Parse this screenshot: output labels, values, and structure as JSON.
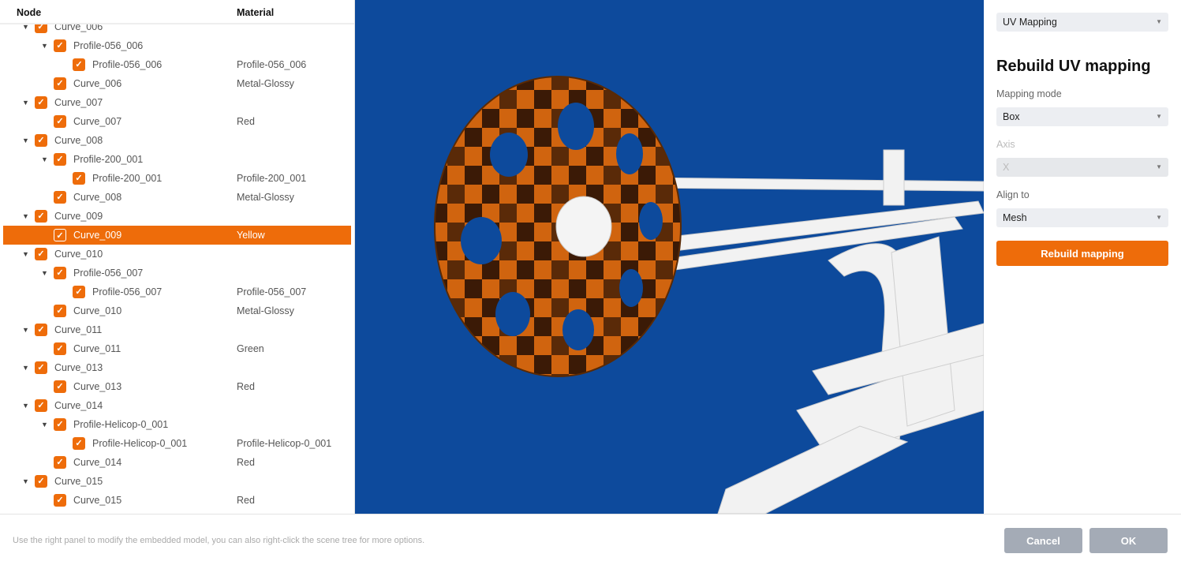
{
  "tree": {
    "headers": {
      "node": "Node",
      "material": "Material"
    },
    "rows": [
      {
        "name": "Curve_006",
        "level": 0,
        "material": "",
        "expander": true
      },
      {
        "name": "Profile-056_006",
        "level": 1,
        "material": "",
        "expander": true
      },
      {
        "name": "Profile-056_006",
        "level": 2,
        "material": "Profile-056_006",
        "expander": false
      },
      {
        "name": "Curve_006",
        "level": 1,
        "material": "Metal-Glossy",
        "expander": false
      },
      {
        "name": "Curve_007",
        "level": 0,
        "material": "",
        "expander": true
      },
      {
        "name": "Curve_007",
        "level": 1,
        "material": "Red",
        "expander": false
      },
      {
        "name": "Curve_008",
        "level": 0,
        "material": "",
        "expander": true
      },
      {
        "name": "Profile-200_001",
        "level": 1,
        "material": "",
        "expander": true
      },
      {
        "name": "Profile-200_001",
        "level": 2,
        "material": "Profile-200_001",
        "expander": false
      },
      {
        "name": "Curve_008",
        "level": 1,
        "material": "Metal-Glossy",
        "expander": false
      },
      {
        "name": "Curve_009",
        "level": 0,
        "material": "",
        "expander": true
      },
      {
        "name": "Curve_009",
        "level": 1,
        "material": "Yellow",
        "expander": false,
        "selected": true
      },
      {
        "name": "Curve_010",
        "level": 0,
        "material": "",
        "expander": true
      },
      {
        "name": "Profile-056_007",
        "level": 1,
        "material": "",
        "expander": true
      },
      {
        "name": "Profile-056_007",
        "level": 2,
        "material": "Profile-056_007",
        "expander": false
      },
      {
        "name": "Curve_010",
        "level": 1,
        "material": "Metal-Glossy",
        "expander": false
      },
      {
        "name": "Curve_011",
        "level": 0,
        "material": "",
        "expander": true
      },
      {
        "name": "Curve_011",
        "level": 1,
        "material": "Green",
        "expander": false
      },
      {
        "name": "Curve_013",
        "level": 0,
        "material": "",
        "expander": true
      },
      {
        "name": "Curve_013",
        "level": 1,
        "material": "Red",
        "expander": false
      },
      {
        "name": "Curve_014",
        "level": 0,
        "material": "",
        "expander": true
      },
      {
        "name": "Profile-Helicop-0_001",
        "level": 1,
        "material": "",
        "expander": true
      },
      {
        "name": "Profile-Helicop-0_001",
        "level": 2,
        "material": "Profile-Helicop-0_001",
        "expander": false
      },
      {
        "name": "Curve_014",
        "level": 1,
        "material": "Red",
        "expander": false
      },
      {
        "name": "Curve_015",
        "level": 0,
        "material": "",
        "expander": true
      },
      {
        "name": "Curve_015",
        "level": 1,
        "material": "Red",
        "expander": false
      }
    ]
  },
  "panel": {
    "mode_select": "UV Mapping",
    "title": "Rebuild UV mapping",
    "mapping_mode_label": "Mapping mode",
    "mapping_mode_value": "Box",
    "axis_label": "Axis",
    "axis_value": "X",
    "align_label": "Align to",
    "align_value": "Mesh",
    "rebuild_button": "Rebuild mapping"
  },
  "footer": {
    "hint": "Use the right panel to modify the embedded model, you can also right-click the scene tree for more options.",
    "cancel": "Cancel",
    "ok": "OK"
  },
  "colors": {
    "accent": "#ee6c0a",
    "viewport_bg": "#0d4a9c",
    "button_gray": "#a4abb6"
  },
  "icons": {
    "checkbox": "checkmark-icon",
    "expander": "caret-down-icon",
    "dropdown": "caret-down-icon"
  }
}
